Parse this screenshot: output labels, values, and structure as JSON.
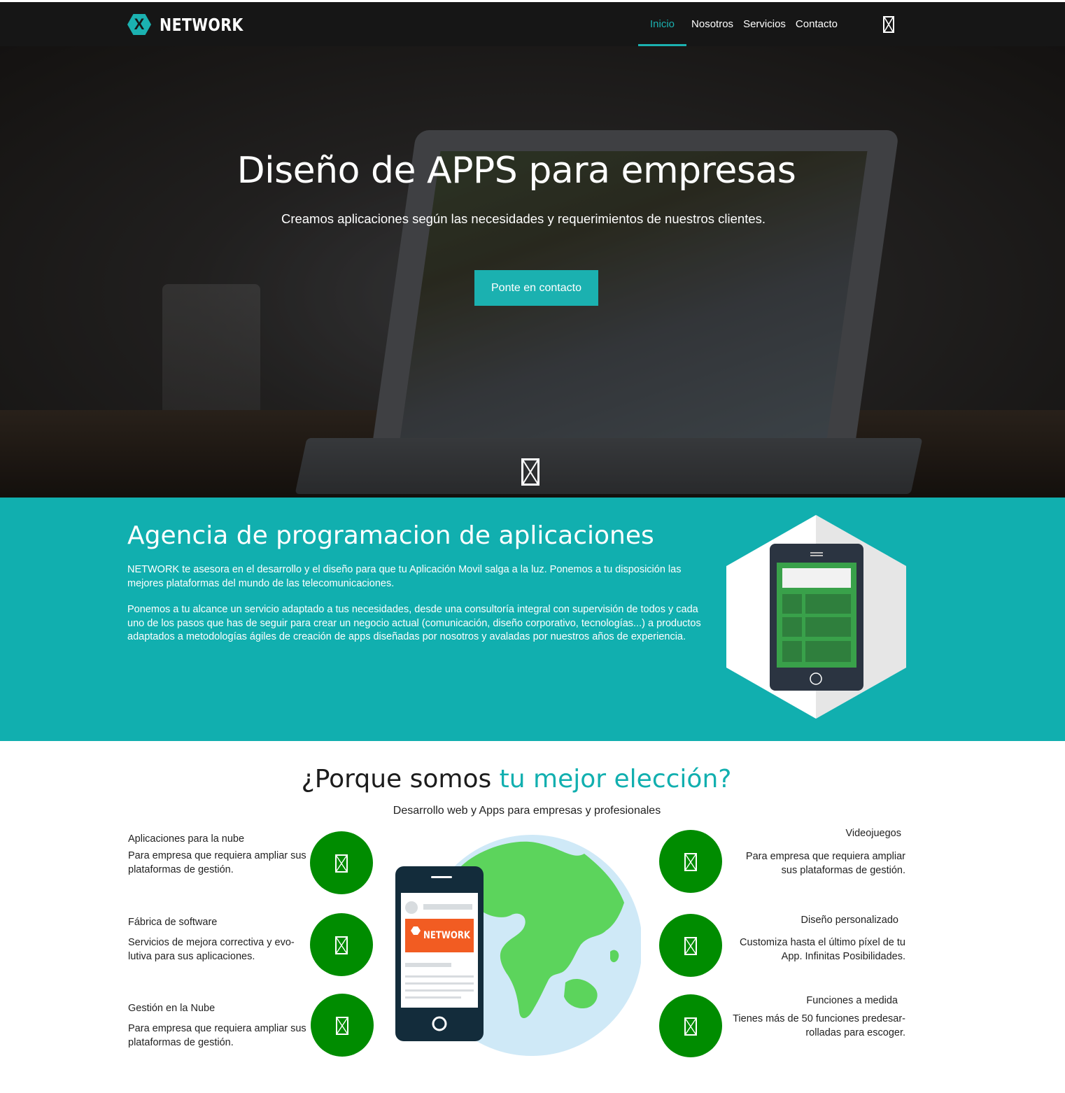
{
  "header": {
    "logo_mark": "X",
    "logo_text": "NETWORK",
    "nav": [
      {
        "label": "Inicio",
        "active": true
      },
      {
        "label": "Nosotros",
        "active": false
      },
      {
        "label": "Servicios",
        "active": false
      },
      {
        "label": "Contacto",
        "active": false
      }
    ],
    "menu_icon": "broken-image-icon"
  },
  "hero": {
    "title": "Diseño de APPS para  empresas",
    "subtitle": "Creamos aplicaciones según las necesidades y requerimientos de nuestros clientes.",
    "cta_label": "Ponte en contacto",
    "scroll_icon": "broken-image-icon"
  },
  "agency": {
    "title": "Agencia de programacion de aplicaciones",
    "paragraph1": "NETWORK te asesora en el desarrollo y el diseño para que tu Aplicación Movil salga a la luz. Ponemos a tu disposición las mejores plataformas del mundo de las telecomunicaciones.",
    "paragraph2": "Ponemos a tu alcance un servicio adaptado a tus necesidades, desde una consultoría integral con supervisión de todos y cada uno de los pasos que has de seguir para crear un negocio actual (comunicación, diseño corporativo, tecnologías...) a productos adaptados a metodologías ágiles de creación de apps diseñadas por nosotros y avaladas por nuestros años de experiencia."
  },
  "why": {
    "title_part1": "¿Porque somos ",
    "title_accent": "tu mejor elección?",
    "subtitle": "Desarrollo web y Apps para empresas y profesionales",
    "phone_logo": "NETWORK",
    "left": [
      {
        "title": "Aplicaciones para la nube",
        "desc": "Para empresa que requiera ampliar sus plataformas de gestión."
      },
      {
        "title": "Fábrica de  software",
        "desc": "Servicios de mejora correctiva y evo-lutiva para sus aplicaciones."
      },
      {
        "title": "Gestión en la Nube",
        "desc": "Para empresa que requiera ampliar sus plataformas de gestión."
      }
    ],
    "right": [
      {
        "title": "Videojuegos ",
        "desc": "Para empresa que requiera ampliar sus plataformas de gestión."
      },
      {
        "title": "Diseño personalizado ",
        "desc": "Customiza hasta el último píxel de tu App. Infinitas Posibilidades."
      },
      {
        "title": "Funciones a medida ",
        "desc": "Tienes más de 50 funciones predesar-rolladas para escoger."
      }
    ]
  },
  "colors": {
    "accent": "#1bb1b0",
    "header_bg": "#161616",
    "agency_bg": "#11afaf",
    "feature_circle": "#008c00"
  }
}
